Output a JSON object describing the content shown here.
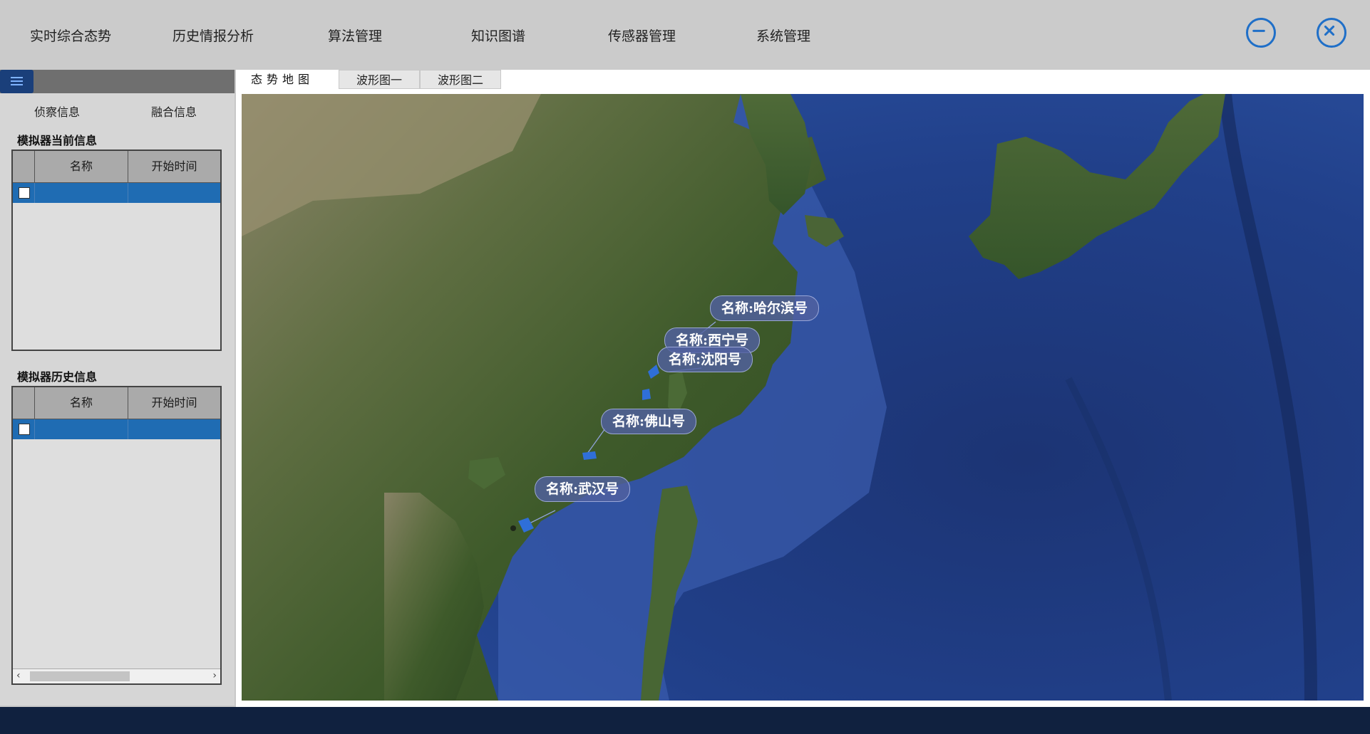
{
  "nav": {
    "items": [
      {
        "label": "实时综合态势"
      },
      {
        "label": "历史情报分析"
      },
      {
        "label": "算法管理"
      },
      {
        "label": "知识图谱"
      },
      {
        "label": "传感器管理"
      },
      {
        "label": "系统管理"
      }
    ],
    "minimize_icon": "minus-circle-icon",
    "close_icon": "x-circle-icon",
    "accent_color": "#1f6fc8"
  },
  "left_panel": {
    "menu_icon": "hamburger-icon",
    "tabs": [
      {
        "label": "侦察信息"
      },
      {
        "label": "融合信息"
      }
    ],
    "current": {
      "title": "模拟器当前信息",
      "columns": [
        "名称",
        "开始时间"
      ]
    },
    "history": {
      "title": "模拟器历史信息",
      "columns": [
        "名称",
        "开始时间"
      ]
    },
    "selected_row_color": "#1f6cb3"
  },
  "content": {
    "tabs": [
      {
        "label": "态势地图",
        "active": true
      },
      {
        "label": "波形图一",
        "active": false
      },
      {
        "label": "波形图二",
        "active": false
      }
    ]
  },
  "map": {
    "ships": [
      {
        "label": "名称:哈尔滨号"
      },
      {
        "label": "名称:西宁号"
      },
      {
        "label": "名称:沈阳号"
      },
      {
        "label": "名称:佛山号"
      },
      {
        "label": "名称:武汉号"
      }
    ]
  }
}
